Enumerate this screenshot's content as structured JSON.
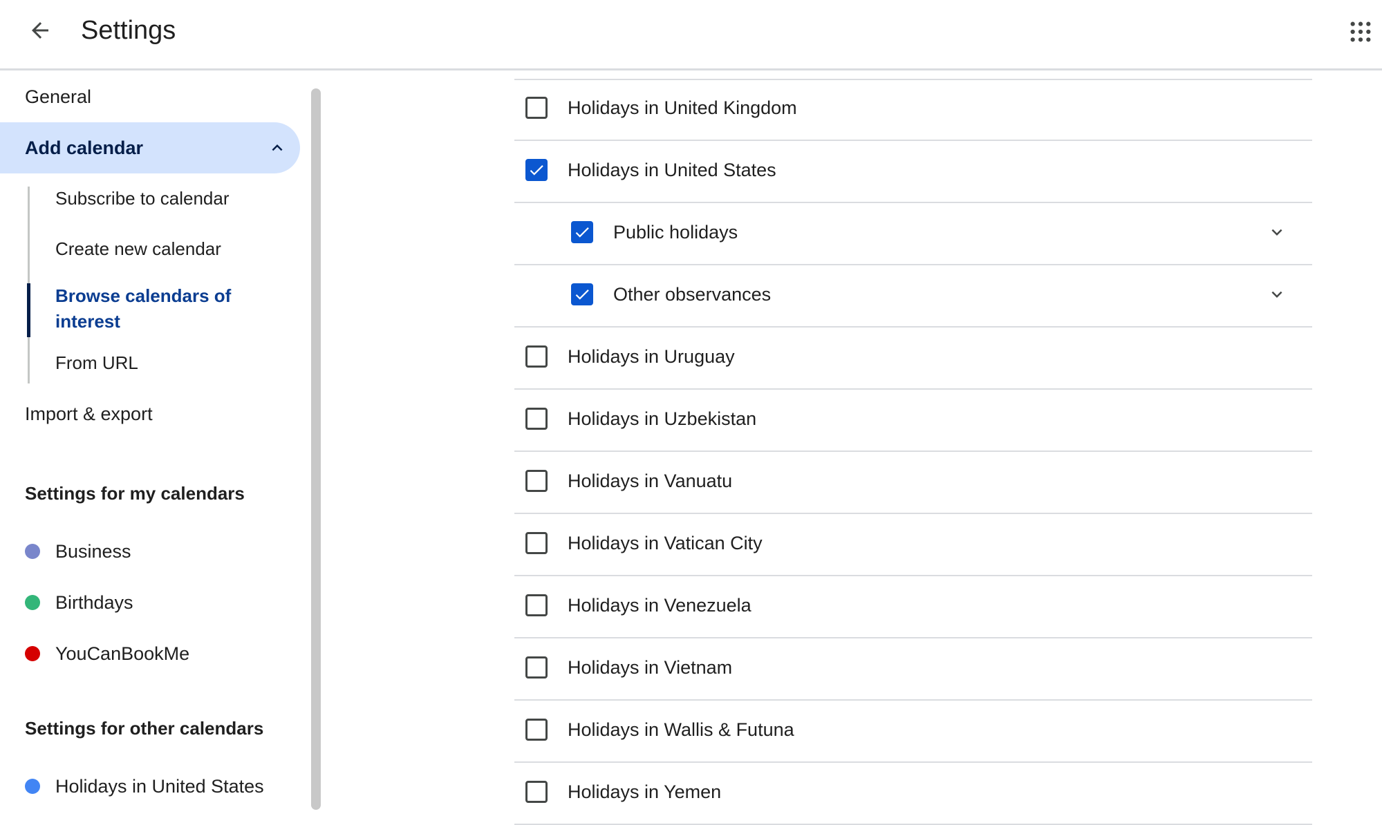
{
  "header": {
    "title": "Settings",
    "back_icon": "arrow-back-icon",
    "apps_icon": "apps-grid-icon"
  },
  "sidebar": {
    "general": "General",
    "add_calendar": "Add calendar",
    "add_calendar_sub": [
      "Subscribe to calendar",
      "Create new calendar",
      "Browse calendars of interest",
      "From URL"
    ],
    "import_export": "Import & export",
    "my_calendars_title": "Settings for my calendars",
    "my_calendars": [
      {
        "label": "Business",
        "color": "#7986cb"
      },
      {
        "label": "Birthdays",
        "color": "#33b679"
      },
      {
        "label": "YouCanBookMe",
        "color": "#d50000"
      }
    ],
    "other_calendars_title": "Settings for other calendars",
    "other_calendars": [
      {
        "label": "Holidays in United States",
        "color": "#4285f4"
      }
    ]
  },
  "main": {
    "rows": [
      {
        "label": "Holidays in United Kingdom",
        "checked": false,
        "indent": false,
        "expandable": false
      },
      {
        "label": "Holidays in United States",
        "checked": true,
        "indent": false,
        "expandable": false
      },
      {
        "label": "Public holidays",
        "checked": true,
        "indent": true,
        "expandable": true
      },
      {
        "label": "Other observances",
        "checked": true,
        "indent": true,
        "expandable": true
      },
      {
        "label": "Holidays in Uruguay",
        "checked": false,
        "indent": false,
        "expandable": false
      },
      {
        "label": "Holidays in Uzbekistan",
        "checked": false,
        "indent": false,
        "expandable": false
      },
      {
        "label": "Holidays in Vanuatu",
        "checked": false,
        "indent": false,
        "expandable": false
      },
      {
        "label": "Holidays in Vatican City",
        "checked": false,
        "indent": false,
        "expandable": false
      },
      {
        "label": "Holidays in Venezuela",
        "checked": false,
        "indent": false,
        "expandable": false
      },
      {
        "label": "Holidays in Vietnam",
        "checked": false,
        "indent": false,
        "expandable": false
      },
      {
        "label": "Holidays in Wallis & Futuna",
        "checked": false,
        "indent": false,
        "expandable": false
      },
      {
        "label": "Holidays in Yemen",
        "checked": false,
        "indent": false,
        "expandable": false
      }
    ]
  },
  "colors": {
    "accent": "#0b57d0",
    "active_nav_bg": "#d3e3fd"
  }
}
